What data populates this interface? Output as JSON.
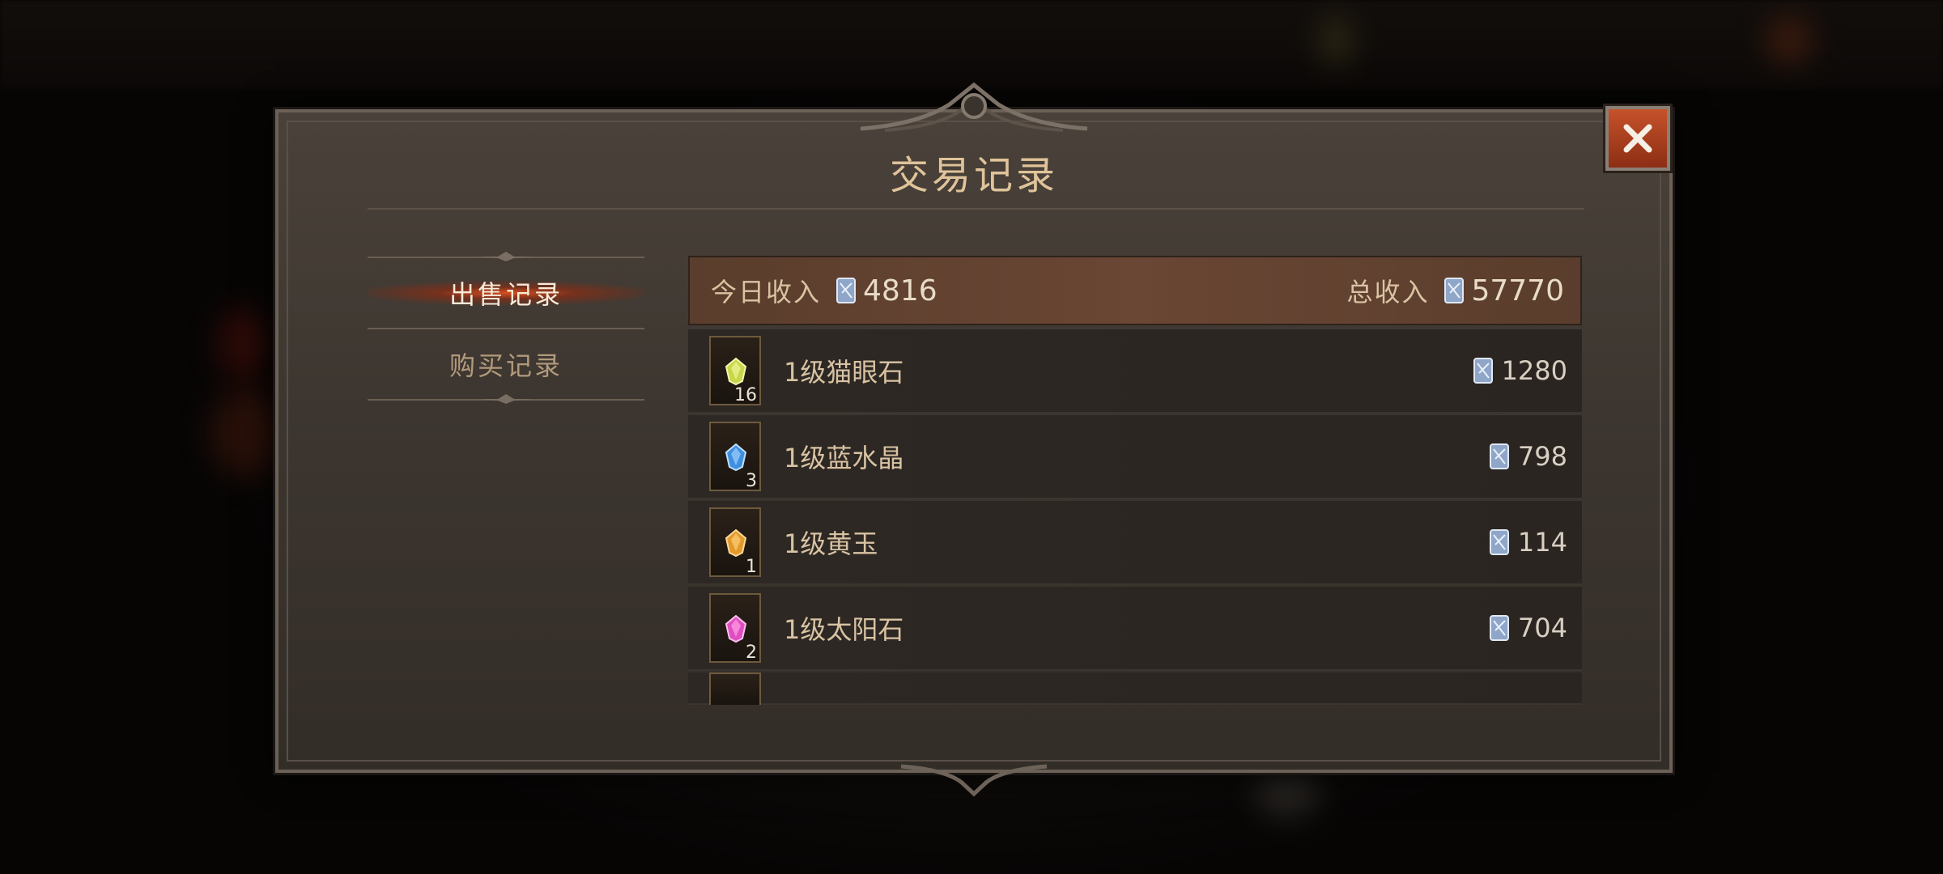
{
  "window": {
    "title": "交易记录"
  },
  "tabs": [
    {
      "label": "出售记录",
      "active": true
    },
    {
      "label": "购买记录",
      "active": false
    }
  ],
  "income": {
    "today_label": "今日收入",
    "today_value": "4816",
    "total_label": "总收入",
    "total_value": "57770",
    "currency_icon": "crystal-icon"
  },
  "records": [
    {
      "name": "1级猫眼石",
      "qty": "16",
      "price": "1280",
      "gem_color": "#c8d64a",
      "icon": "cats-eye-gem-icon"
    },
    {
      "name": "1级蓝水晶",
      "qty": "3",
      "price": "798",
      "gem_color": "#3f8fe0",
      "icon": "sapphire-gem-icon"
    },
    {
      "name": "1级黄玉",
      "qty": "1",
      "price": "114",
      "gem_color": "#e39a2c",
      "icon": "topaz-gem-icon"
    },
    {
      "name": "1级太阳石",
      "qty": "2",
      "price": "704",
      "gem_color": "#e04fc0",
      "icon": "sunstone-gem-icon"
    }
  ],
  "colors": {
    "accent": "#e0c39a",
    "close_button": "#b4441f"
  }
}
